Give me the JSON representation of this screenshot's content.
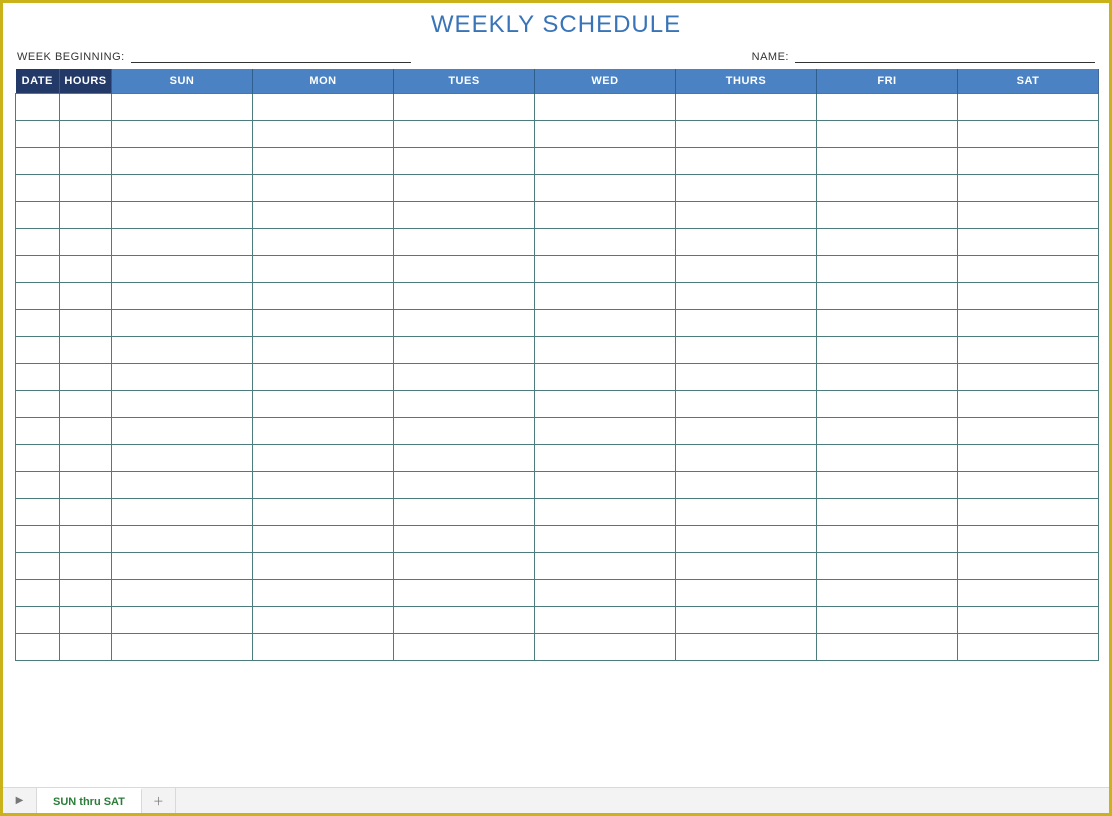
{
  "title": "WEEKLY SCHEDULE",
  "meta": {
    "week_beginning_label": "WEEK BEGINNING:",
    "week_beginning_value": "",
    "name_label": "NAME:",
    "name_value": ""
  },
  "columns": {
    "date": "DATE",
    "hours": "HOURS",
    "days": [
      "SUN",
      "MON",
      "TUES",
      "WED",
      "THURS",
      "FRI",
      "SAT"
    ]
  },
  "row_count": 21,
  "col_widths": {
    "date": 44,
    "hours": 52,
    "day": 141
  },
  "tabs": {
    "active": "SUN thru SAT"
  },
  "chart_data": {
    "type": "table",
    "title": "WEEKLY SCHEDULE",
    "columns": [
      "DATE",
      "HOURS",
      "SUN",
      "MON",
      "TUES",
      "WED",
      "THURS",
      "FRI",
      "SAT"
    ],
    "rows": []
  }
}
